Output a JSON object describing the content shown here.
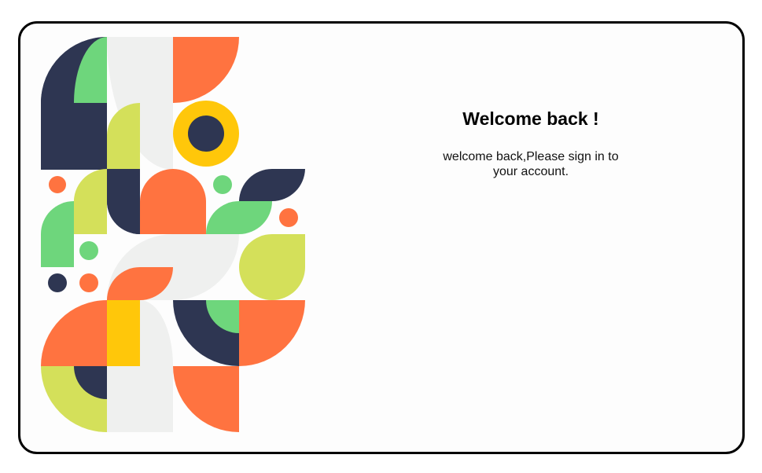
{
  "welcome": {
    "title": "Welcome back !",
    "subtitle": "welcome back,Please sign in to your account."
  },
  "colors": {
    "navy": "#2e3652",
    "green": "#6ed67c",
    "orange": "#ff7340",
    "yellow": "#ffc70a",
    "lime": "#d4e05a",
    "light_gray": "#eff0ef",
    "border": "#000000"
  }
}
